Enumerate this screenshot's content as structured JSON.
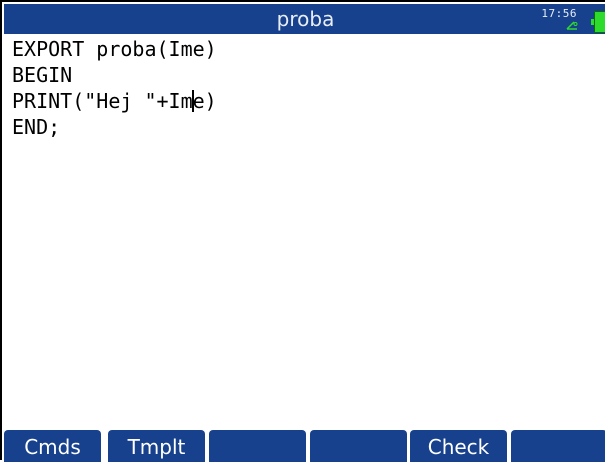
{
  "titlebar": {
    "title": "proba",
    "clock": "17:56",
    "colors": {
      "background": "#17418c",
      "battery": "#2ddb2d"
    },
    "icons": [
      "angle-mode-icon",
      "battery-icon"
    ]
  },
  "editor": {
    "lines": [
      "EXPORT proba(Ime)",
      "BEGIN",
      "PRINT(\"Hej \"+Ime)",
      "END;"
    ],
    "cursor_line_before": "PRINT(\"Hej \"+Im",
    "cursor_line_after": "e)"
  },
  "softkeys": [
    {
      "label": "Cmds"
    },
    {
      "label": "Tmplt"
    },
    {
      "label": ""
    },
    {
      "label": ""
    },
    {
      "label": "Check"
    },
    {
      "label": ""
    }
  ]
}
